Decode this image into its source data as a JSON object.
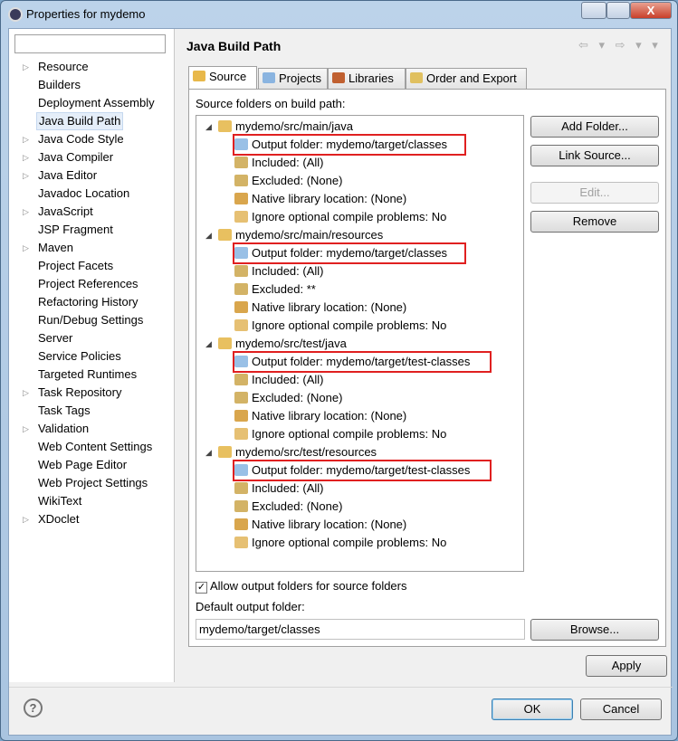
{
  "window": {
    "title": "Properties for mydemo",
    "close": "X"
  },
  "sidebar": {
    "filter_value": "",
    "items": [
      {
        "label": "Resource",
        "expandable": true
      },
      {
        "label": "Builders"
      },
      {
        "label": "Deployment Assembly"
      },
      {
        "label": "Java Build Path",
        "selected": true
      },
      {
        "label": "Java Code Style",
        "expandable": true
      },
      {
        "label": "Java Compiler",
        "expandable": true
      },
      {
        "label": "Java Editor",
        "expandable": true
      },
      {
        "label": "Javadoc Location"
      },
      {
        "label": "JavaScript",
        "expandable": true
      },
      {
        "label": "JSP Fragment"
      },
      {
        "label": "Maven",
        "expandable": true
      },
      {
        "label": "Project Facets"
      },
      {
        "label": "Project References"
      },
      {
        "label": "Refactoring History"
      },
      {
        "label": "Run/Debug Settings"
      },
      {
        "label": "Server"
      },
      {
        "label": "Service Policies"
      },
      {
        "label": "Targeted Runtimes"
      },
      {
        "label": "Task Repository",
        "expandable": true
      },
      {
        "label": "Task Tags"
      },
      {
        "label": "Validation",
        "expandable": true
      },
      {
        "label": "Web Content Settings"
      },
      {
        "label": "Web Page Editor"
      },
      {
        "label": "Web Project Settings"
      },
      {
        "label": "WikiText"
      },
      {
        "label": "XDoclet",
        "expandable": true
      }
    ]
  },
  "header": {
    "title": "Java Build Path",
    "nav_icons": "⇦ ▾ ⇨ ▾ ▾"
  },
  "tabs": [
    {
      "label": "Source",
      "active": true,
      "icon": "source-folder-icon"
    },
    {
      "label": "Projects",
      "icon": "project-folder-icon"
    },
    {
      "label": "Libraries",
      "icon": "libraries-icon"
    },
    {
      "label": "Order and Export",
      "icon": "order-icon"
    }
  ],
  "source": {
    "label": "Source folders on build path:",
    "folders": [
      {
        "name": "mydemo/src/main/java",
        "output": "Output folder: mydemo/target/classes",
        "included": "Included: (All)",
        "excluded": "Excluded: (None)",
        "native": "Native library location: (None)",
        "ignore": "Ignore optional compile problems: No"
      },
      {
        "name": "mydemo/src/main/resources",
        "output": "Output folder: mydemo/target/classes",
        "included": "Included: (All)",
        "excluded": "Excluded: **",
        "native": "Native library location: (None)",
        "ignore": "Ignore optional compile problems: No"
      },
      {
        "name": "mydemo/src/test/java",
        "output": "Output folder: mydemo/target/test-classes",
        "included": "Included: (All)",
        "excluded": "Excluded: (None)",
        "native": "Native library location: (None)",
        "ignore": "Ignore optional compile problems: No"
      },
      {
        "name": "mydemo/src/test/resources",
        "output": "Output folder: mydemo/target/test-classes",
        "included": "Included: (All)",
        "excluded": "Excluded: (None)",
        "native": "Native library location: (None)",
        "ignore": "Ignore optional compile problems: No"
      }
    ],
    "buttons": {
      "add_folder": "Add Folder...",
      "link_source": "Link Source...",
      "edit": "Edit...",
      "remove": "Remove",
      "browse": "Browse..."
    },
    "allow_output_label": "Allow output folders for source folders",
    "allow_output_checked": true,
    "default_output_label": "Default output folder:",
    "default_output_value": "mydemo/target/classes"
  },
  "footer": {
    "apply": "Apply",
    "ok": "OK",
    "cancel": "Cancel",
    "help": "?"
  },
  "colors": {
    "highlight": "#e02020",
    "selection": "#e5eef9"
  }
}
